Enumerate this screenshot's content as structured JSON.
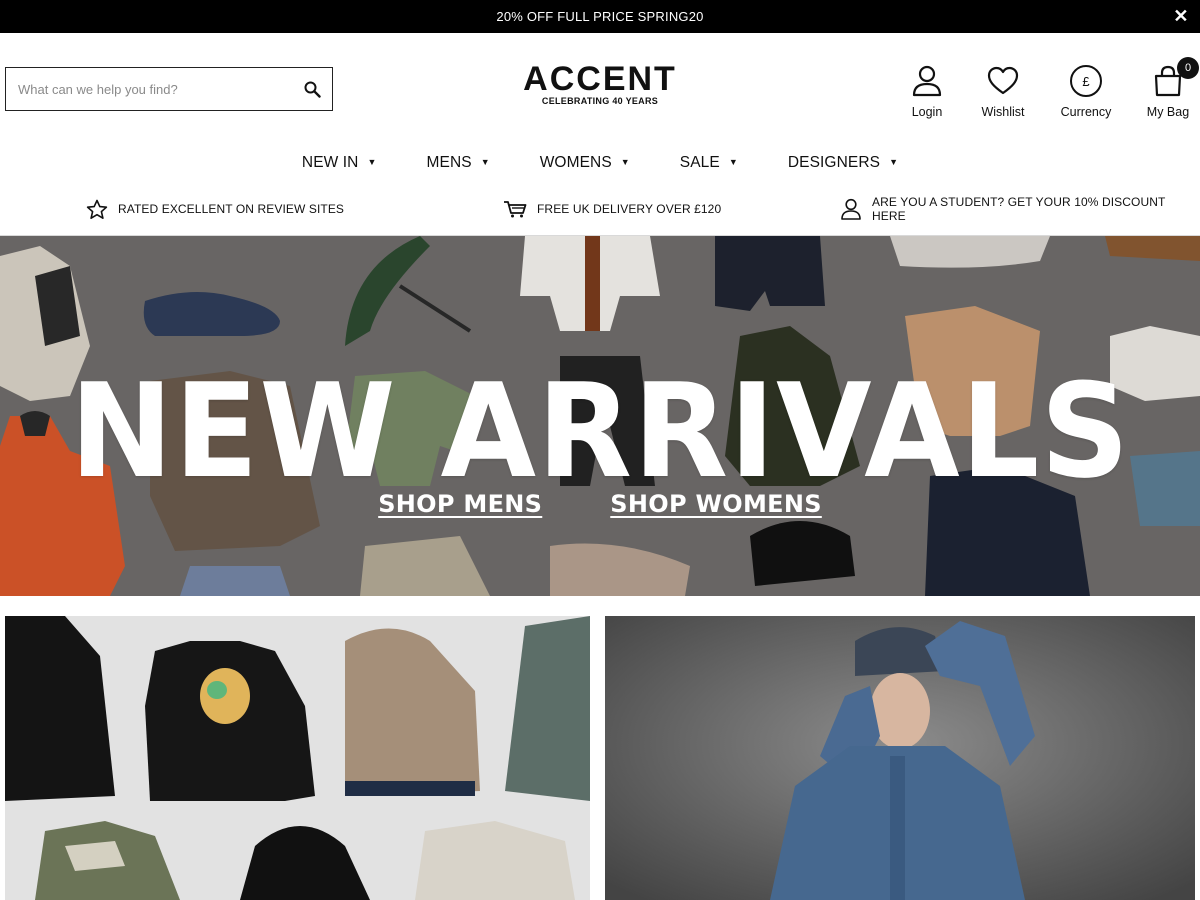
{
  "promo_bar": {
    "text": "20% OFF FULL PRICE SPRING20",
    "close_glyph": "✕"
  },
  "search": {
    "placeholder": "What can we help you find?",
    "icon": "search-icon"
  },
  "logo": {
    "name": "ACCENT",
    "tagline": "CELEBRATING 40 YEARS"
  },
  "account": {
    "login": "Login",
    "wishlist": "Wishlist",
    "currency": "Currency",
    "currency_symbol": "£",
    "bag": "My Bag",
    "bag_count": "0"
  },
  "nav": {
    "items": [
      {
        "label": "NEW IN"
      },
      {
        "label": "MENS"
      },
      {
        "label": "WOMENS"
      },
      {
        "label": "SALE"
      },
      {
        "label": "DESIGNERS"
      }
    ]
  },
  "usp": {
    "items": [
      {
        "label": "RATED EXCELLENT ON REVIEW SITES",
        "icon": "star-icon"
      },
      {
        "label": "FREE UK DELIVERY OVER £120",
        "icon": "cart-icon"
      },
      {
        "label": "ARE YOU A STUDENT? GET YOUR 10% DISCOUNT HERE",
        "icon": "user-icon"
      }
    ]
  },
  "hero": {
    "title": "NEW ARRIVALS",
    "shop_mens": "SHOP MENS",
    "shop_womens": "SHOP WOMENS"
  },
  "colors": {
    "promo_bg": "#000000",
    "hero_bg": "#6f6c6b",
    "text": "#111111"
  }
}
